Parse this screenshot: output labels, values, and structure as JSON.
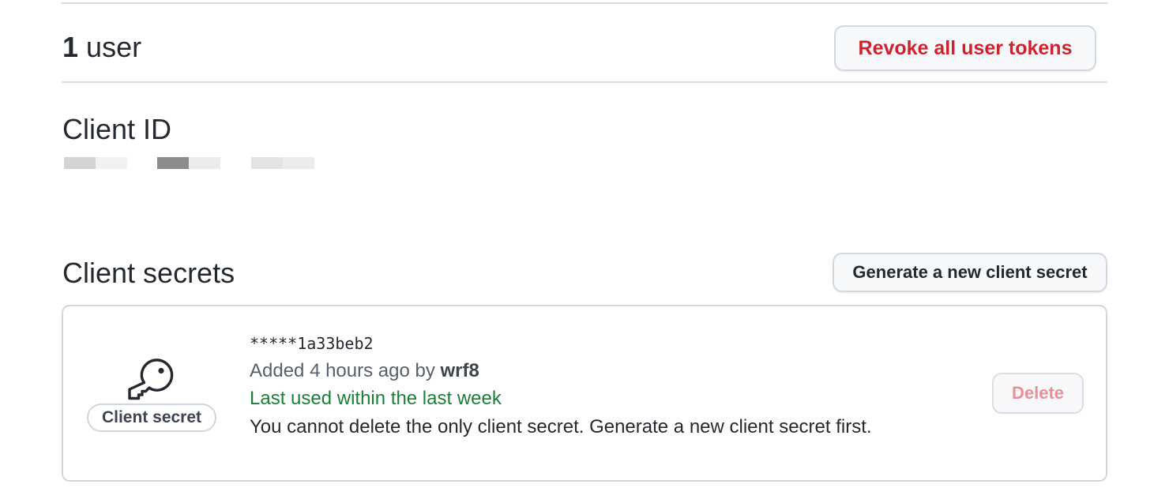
{
  "users": {
    "count": "1",
    "label": "user",
    "revoke_button": "Revoke all user tokens"
  },
  "client_id": {
    "heading": "Client ID"
  },
  "client_secrets": {
    "heading": "Client secrets",
    "generate_button": "Generate a new client secret",
    "secret": {
      "icon": "key-icon",
      "badge": "Client secret",
      "value": "*****1a33beb2",
      "added_prefix": "Added 4 hours ago by",
      "added_by": "wrf8",
      "last_used": "Last used within the last week",
      "note": "You cannot delete the only client secret. Generate a new client secret first.",
      "delete_button": "Delete"
    }
  },
  "colors": {
    "danger": "#cf222e",
    "success": "#1a7f37",
    "border": "#d0d7de",
    "button_bg": "#f6f8fa"
  }
}
